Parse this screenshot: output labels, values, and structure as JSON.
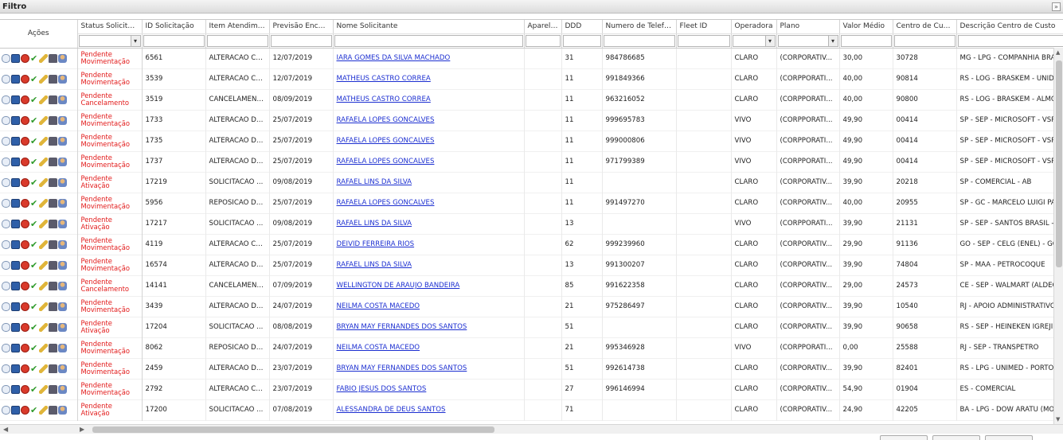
{
  "filter_bar": {
    "title": "Filtro",
    "collapse_icon": "double-chevron-icon"
  },
  "columns": [
    "Ações",
    "Status Solicitação",
    "ID Solicitação",
    "Item Atendime...",
    "Previsão Encerr...",
    "Nome Solicitante",
    "Aparelho",
    "DDD",
    "Numero de Telefone",
    "Fleet ID",
    "Operadora",
    "Plano",
    "Valor Médio",
    "Centro de Custo",
    "Descrição Centro de Custo"
  ],
  "row_action_icons": [
    "chat-icon",
    "book-icon",
    "stop-icon",
    "check-icon",
    "pencil-icon",
    "phone-icon",
    "person-icon"
  ],
  "rows": [
    {
      "status": "Pendente Movimentação",
      "id": "6561",
      "item": "ALTERACAO CE...",
      "previsao": "12/07/2019",
      "nome": "IARA GOMES DA SILVA MACHADO",
      "aparelho": "",
      "ddd": "31",
      "telefone": "984786685",
      "fleet": "",
      "operadora": "CLARO",
      "plano": "(CORPORATIV...",
      "valor": "30,00",
      "centro": "30728",
      "descricao": "MG - LPG - COMPANHIA BRAS"
    },
    {
      "status": "Pendente Movimentação",
      "id": "3539",
      "item": "ALTERACAO CE...",
      "previsao": "12/07/2019",
      "nome": "MATHEUS CASTRO CORREA",
      "aparelho": "",
      "ddd": "11",
      "telefone": "991849366",
      "fleet": "",
      "operadora": "CLARO",
      "plano": "(CORPPORATI...",
      "valor": "40,00",
      "centro": "90814",
      "descricao": "RS - LOG - BRASKEM - UNIDA"
    },
    {
      "status": "Pendente Cancelamento",
      "id": "3519",
      "item": "CANCELAMENTO",
      "previsao": "08/09/2019",
      "nome": "MATHEUS CASTRO CORREA",
      "aparelho": "",
      "ddd": "11",
      "telefone": "963216052",
      "fleet": "",
      "operadora": "CLARO",
      "plano": "(CORPPORATI...",
      "valor": "40,00",
      "centro": "90800",
      "descricao": "RS - LOG - BRASKEM - ALMOX"
    },
    {
      "status": "Pendente Movimentação",
      "id": "1733",
      "item": "ALTERACAO DE...",
      "previsao": "25/07/2019",
      "nome": "RAFAELA LOPES GONCALVES",
      "aparelho": "",
      "ddd": "11",
      "telefone": "999695783",
      "fleet": "",
      "operadora": "VIVO",
      "plano": "(CORPPORATI...",
      "valor": "49,90",
      "centro": "00414",
      "descricao": "SP - SEP - MICROSOFT - VSPP"
    },
    {
      "status": "Pendente Movimentação",
      "id": "1735",
      "item": "ALTERACAO DE...",
      "previsao": "25/07/2019",
      "nome": "RAFAELA LOPES GONCALVES",
      "aparelho": "",
      "ddd": "11",
      "telefone": "999000806",
      "fleet": "",
      "operadora": "VIVO",
      "plano": "(CORPPORATI...",
      "valor": "49,90",
      "centro": "00414",
      "descricao": "SP - SEP - MICROSOFT - VSPP"
    },
    {
      "status": "Pendente Movimentação",
      "id": "1737",
      "item": "ALTERACAO DE...",
      "previsao": "25/07/2019",
      "nome": "RAFAELA LOPES GONCALVES",
      "aparelho": "",
      "ddd": "11",
      "telefone": "971799389",
      "fleet": "",
      "operadora": "VIVO",
      "plano": "(CORPPORATI...",
      "valor": "49,90",
      "centro": "00414",
      "descricao": "SP - SEP - MICROSOFT - VSPP"
    },
    {
      "status": "Pendente Ativação",
      "id": "17219",
      "item": "SOLICITACAO ...",
      "previsao": "09/08/2019",
      "nome": "RAFAEL LINS DA SILVA",
      "aparelho": "",
      "ddd": "11",
      "telefone": "",
      "fleet": "",
      "operadora": "CLARO",
      "plano": "(CORPORATIV...",
      "valor": "39,90",
      "centro": "20218",
      "descricao": "SP - COMERCIAL - AB"
    },
    {
      "status": "Pendente Movimentação",
      "id": "5956",
      "item": "REPOSICAO DE ...",
      "previsao": "25/07/2019",
      "nome": "RAFAELA LOPES GONCALVES",
      "aparelho": "",
      "ddd": "11",
      "telefone": "991497270",
      "fleet": "",
      "operadora": "CLARO",
      "plano": "(CORPORATIV...",
      "valor": "40,00",
      "centro": "20955",
      "descricao": "SP - GC - MARCELO LUIGI PAI"
    },
    {
      "status": "Pendente Ativação",
      "id": "17217",
      "item": "SOLICITACAO ...",
      "previsao": "09/08/2019",
      "nome": "RAFAEL LINS DA SILVA",
      "aparelho": "",
      "ddd": "13",
      "telefone": "",
      "fleet": "",
      "operadora": "VIVO",
      "plano": "(CORPPORATI...",
      "valor": "39,90",
      "centro": "21131",
      "descricao": "SP - SEP - SANTOS BRASIL - S"
    },
    {
      "status": "Pendente Movimentação",
      "id": "4119",
      "item": "ALTERACAO CE...",
      "previsao": "25/07/2019",
      "nome": "DEIVID FERREIRA RIOS",
      "aparelho": "",
      "ddd": "62",
      "telefone": "999239960",
      "fleet": "",
      "operadora": "CLARO",
      "plano": "(CORPORATIV...",
      "valor": "29,90",
      "centro": "91136",
      "descricao": "GO - SEP - CELG (ENEL) - GOI"
    },
    {
      "status": "Pendente Movimentação",
      "id": "16574",
      "item": "ALTERACAO DE...",
      "previsao": "25/07/2019",
      "nome": "RAFAEL LINS DA SILVA",
      "aparelho": "",
      "ddd": "13",
      "telefone": "991300207",
      "fleet": "",
      "operadora": "CLARO",
      "plano": "(CORPORATIV...",
      "valor": "39,90",
      "centro": "74804",
      "descricao": "SP - MAA - PETROCOQUE"
    },
    {
      "status": "Pendente Cancelamento",
      "id": "14141",
      "item": "CANCELAMENTO",
      "previsao": "07/09/2019",
      "nome": "WELLINGTON DE ARAUJO BANDEIRA",
      "aparelho": "",
      "ddd": "85",
      "telefone": "991622358",
      "fleet": "",
      "operadora": "CLARO",
      "plano": "(CORPORATIV...",
      "valor": "29,00",
      "centro": "24573",
      "descricao": "CE - SEP - WALMART (ALDEOT"
    },
    {
      "status": "Pendente Movimentação",
      "id": "3439",
      "item": "ALTERACAO DE...",
      "previsao": "24/07/2019",
      "nome": "NEILMA COSTA MACEDO",
      "aparelho": "",
      "ddd": "21",
      "telefone": "975286497",
      "fleet": "",
      "operadora": "CLARO",
      "plano": "(CORPORATIV...",
      "valor": "39,90",
      "centro": "10540",
      "descricao": "RJ - APOIO ADMINISTRATIVO"
    },
    {
      "status": "Pendente Ativação",
      "id": "17204",
      "item": "SOLICITACAO ...",
      "previsao": "08/08/2019",
      "nome": "BRYAN MAY FERNANDES DOS SANTOS",
      "aparelho": "",
      "ddd": "51",
      "telefone": "",
      "fleet": "",
      "operadora": "CLARO",
      "plano": "(CORPORATIV...",
      "valor": "39,90",
      "centro": "90658",
      "descricao": "RS - SEP - HEINEKEN IGREJIN"
    },
    {
      "status": "Pendente Movimentação",
      "id": "8062",
      "item": "REPOSICAO DE ...",
      "previsao": "24/07/2019",
      "nome": "NEILMA COSTA MACEDO",
      "aparelho": "",
      "ddd": "21",
      "telefone": "995346928",
      "fleet": "",
      "operadora": "VIVO",
      "plano": "(CORPPORATI...",
      "valor": "0,00",
      "centro": "25588",
      "descricao": "RJ - SEP - TRANSPETRO"
    },
    {
      "status": "Pendente Movimentação",
      "id": "2459",
      "item": "ALTERACAO DE...",
      "previsao": "23/07/2019",
      "nome": "BRYAN MAY FERNANDES DOS SANTOS",
      "aparelho": "",
      "ddd": "51",
      "telefone": "992614738",
      "fleet": "",
      "operadora": "CLARO",
      "plano": "(CORPORATIV...",
      "valor": "39,90",
      "centro": "82401",
      "descricao": "RS - LPG - UNIMED - PORTO A"
    },
    {
      "status": "Pendente Movimentação",
      "id": "2792",
      "item": "ALTERACAO CE...",
      "previsao": "23/07/2019",
      "nome": "FABIO JESUS DOS SANTOS",
      "aparelho": "",
      "ddd": "27",
      "telefone": "996146994",
      "fleet": "",
      "operadora": "CLARO",
      "plano": "(CORPORATIV...",
      "valor": "54,90",
      "centro": "01904",
      "descricao": "ES - COMERCIAL"
    },
    {
      "status": "Pendente Ativação",
      "id": "17200",
      "item": "SOLICITACAO ...",
      "previsao": "07/08/2019",
      "nome": "ALESSANDRA DE DEUS SANTOS",
      "aparelho": "",
      "ddd": "71",
      "telefone": "",
      "fleet": "",
      "operadora": "CLARO",
      "plano": "(CORPORATIV...",
      "valor": "24,90",
      "centro": "42205",
      "descricao": "BA - LPG - DOW ARATU (MOP"
    }
  ]
}
